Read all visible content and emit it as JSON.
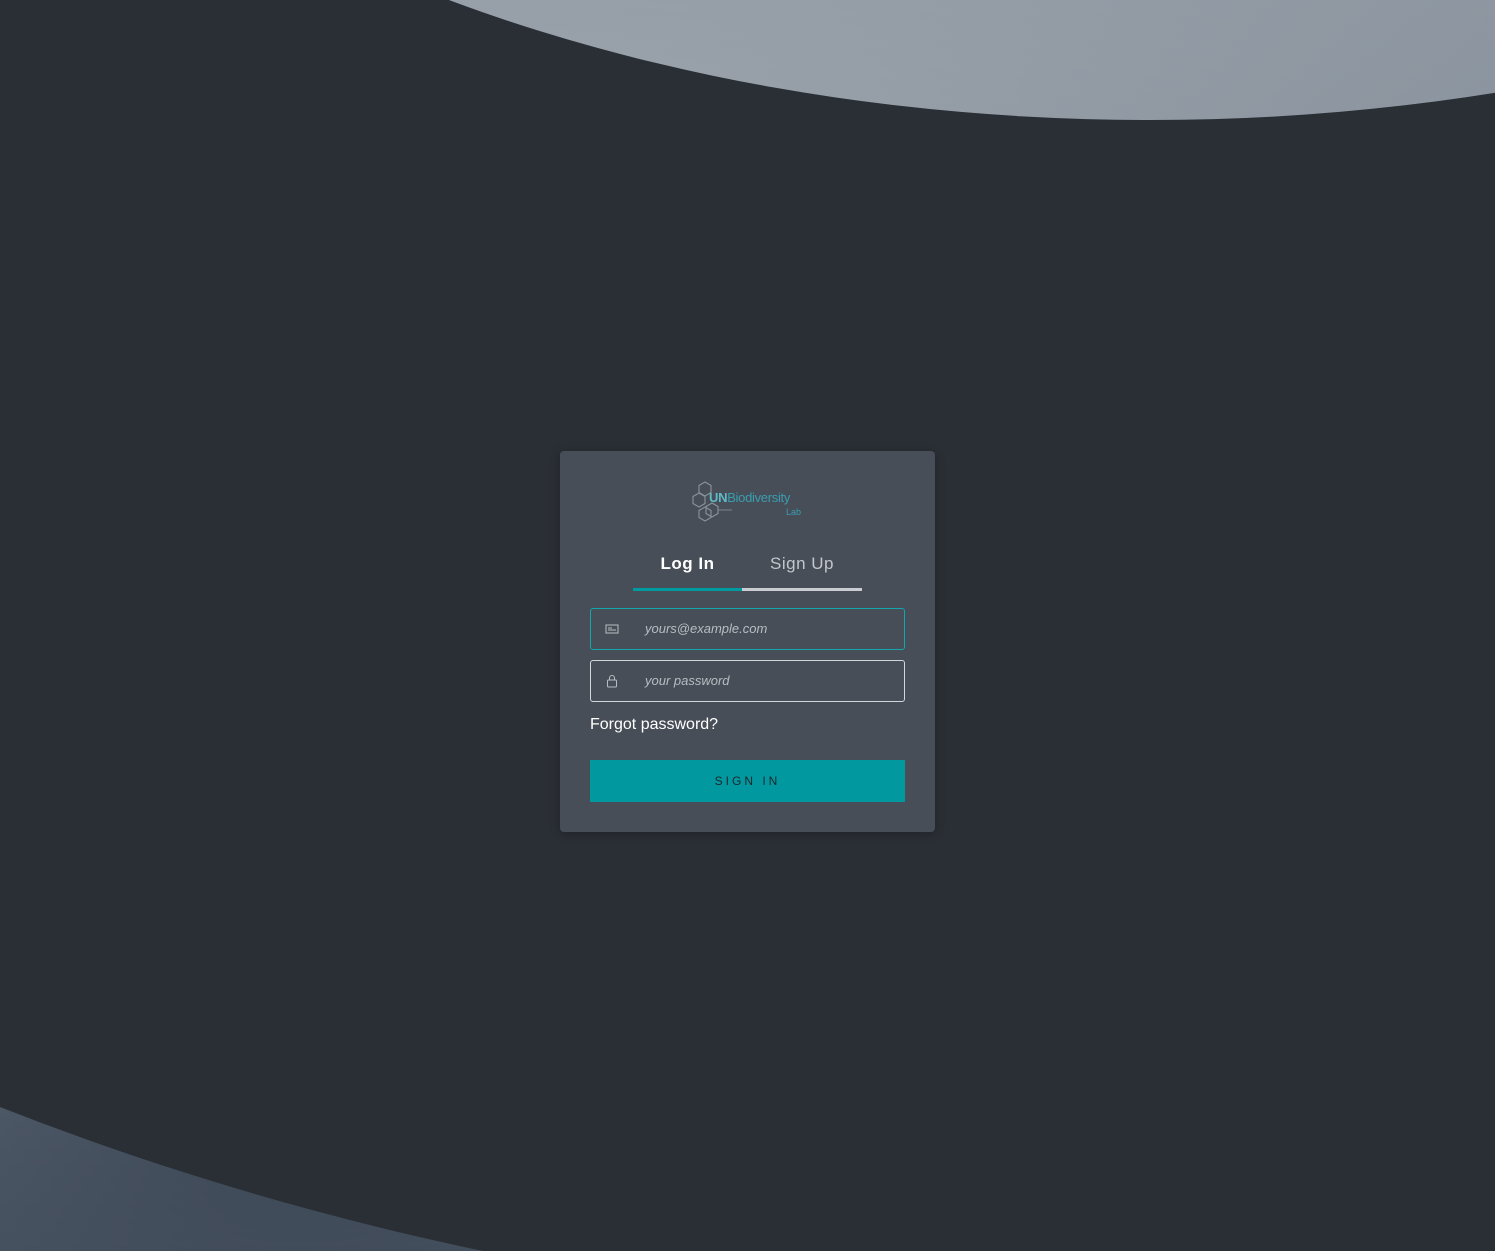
{
  "logo": {
    "name_prefix": "UN",
    "name_main": "Biodiversity",
    "name_sub": "Lab"
  },
  "tabs": {
    "login_label": "Log In",
    "signup_label": "Sign Up",
    "active": "login"
  },
  "form": {
    "email_placeholder": "yours@example.com",
    "email_icon": "envelope-icon",
    "password_placeholder": "your password",
    "password_icon": "lock-icon",
    "forgot_label": "Forgot password?",
    "submit_label": "SIGN IN"
  },
  "colors": {
    "accent": "#02989f",
    "card_bg": "#474e57",
    "active_tab_underline": "#009aa1"
  }
}
